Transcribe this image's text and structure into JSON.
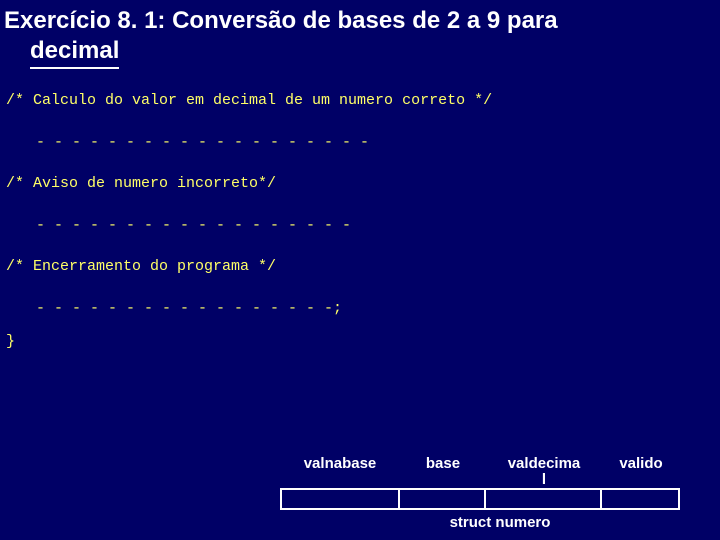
{
  "title": {
    "line1": "Exercício 8. 1: Conversão de bases de 2 a 9 para",
    "line2": "decimal"
  },
  "code": {
    "comment1": "/* Calculo do valor em decimal de um numero correto */",
    "dashes1": "- - - - - - - - - - - - - - - - - - -",
    "comment2": "/* Aviso de numero incorreto*/",
    "dashes2": "- - - - - - - - - - - - - - - - - -",
    "comment3": "/* Encerramento do programa */",
    "dashes3": "- - - - - - - - - - - - - - - - -;",
    "brace": "}"
  },
  "table": {
    "fields": [
      "valnabase",
      "base",
      "valdecima\nl",
      "valido"
    ],
    "struct_label": "struct numero"
  }
}
